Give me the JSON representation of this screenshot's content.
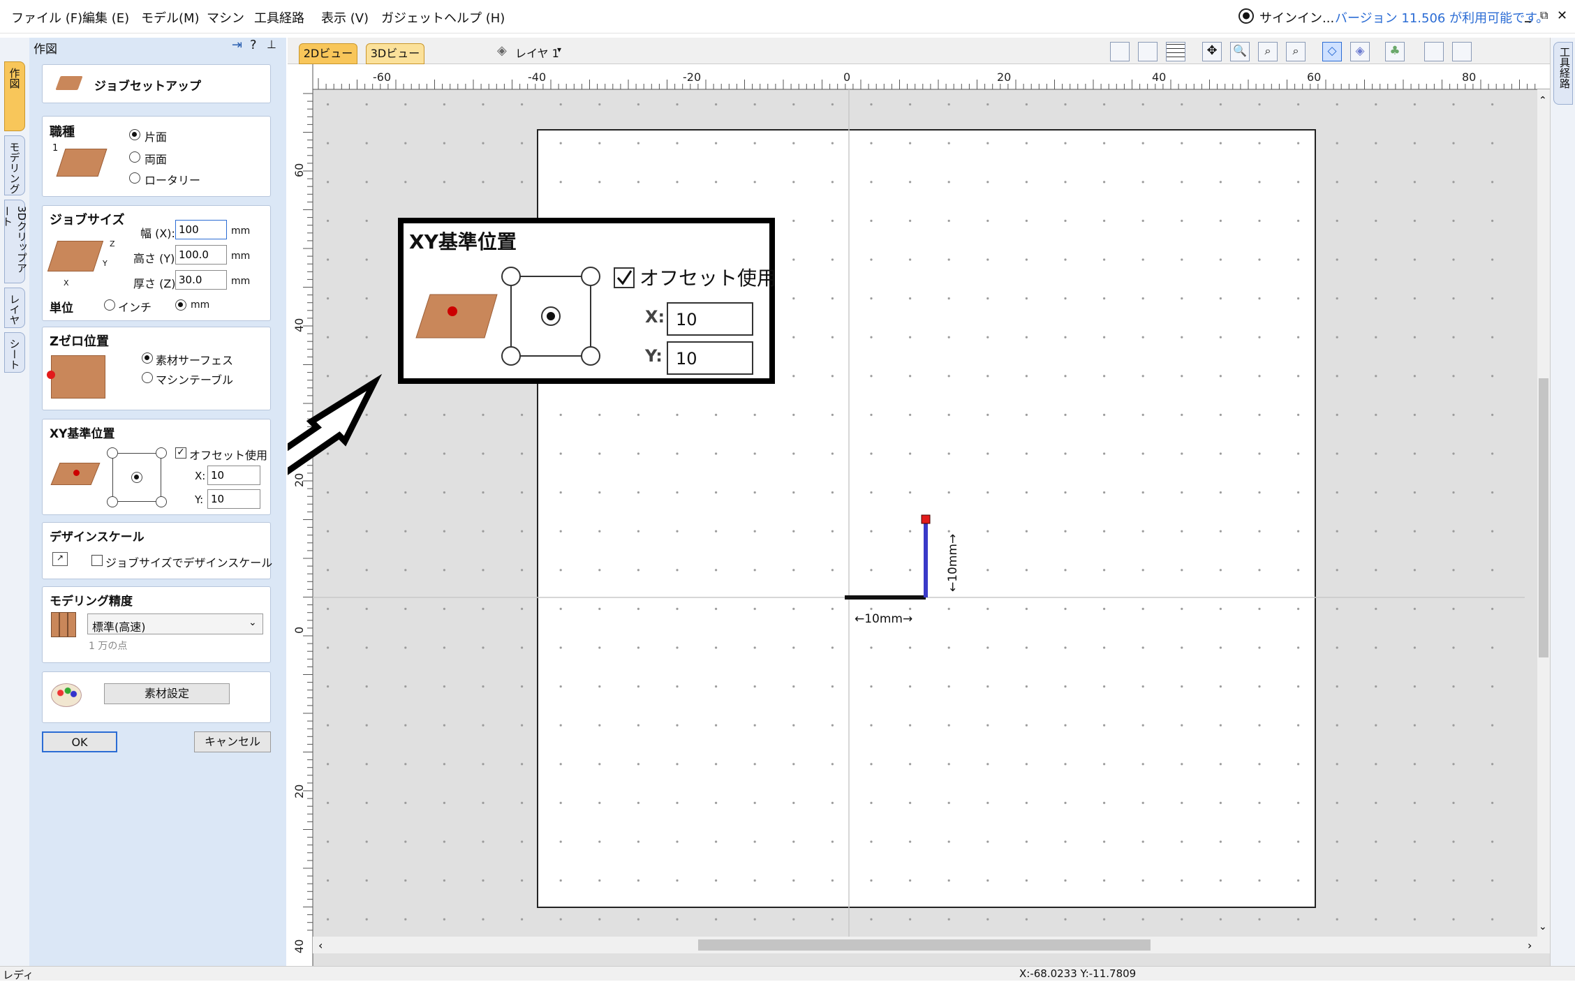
{
  "menu": {
    "items": [
      "ファイル (F)",
      "編集 (E)",
      "モデル(M)",
      "マシン",
      "工具経路",
      "表示 (V)",
      "ガジェット",
      "ヘルプ (H)"
    ],
    "signin": "サインイン...",
    "version_notice": "バージョン 11.506 が利用可能です。"
  },
  "left_tabs": [
    "作図",
    "モデリング",
    "3Dクリップアート",
    "レイヤ",
    "シート"
  ],
  "panel": {
    "title": "作図",
    "job_setup_label": "ジョブセットアップ",
    "job_type": {
      "title": "職種",
      "options": [
        "片面",
        "両面",
        "ロータリー"
      ],
      "selected": "片面"
    },
    "job_size": {
      "title": "ジョブサイズ",
      "width_label": "幅 (X):",
      "width_value": "100",
      "height_label": "高さ (Y):",
      "height_value": "100.0",
      "thickness_label": "厚さ (Z):",
      "thickness_value": "30.0",
      "unit_suffix": "mm",
      "units_title": "単位",
      "unit_options": [
        "インチ",
        "mm"
      ],
      "unit_selected": "mm"
    },
    "z_zero": {
      "title": "Zゼロ位置",
      "options": [
        "素材サーフェス",
        "マシンテーブル"
      ],
      "selected": "素材サーフェス"
    },
    "xy_datum": {
      "title": "XY基準位置",
      "offset_label": "オフセット使用",
      "offset_checked": true,
      "x_label": "X:",
      "x_value": "10",
      "y_label": "Y:",
      "y_value": "10"
    },
    "design_scale": {
      "title": "デザインスケール",
      "checkbox_label": "ジョブサイズでデザインスケール",
      "checked": false
    },
    "modeling": {
      "title": "モデリング精度",
      "selected": "標準(高速)",
      "note": "1 万の点"
    },
    "material_button": "素材設定",
    "ok_button": "OK",
    "cancel_button": "キャンセル"
  },
  "view_tabs": [
    "2Dビュー",
    "3Dビュー"
  ],
  "layer_selector": "レイヤ 1",
  "ruler": {
    "h_ticks": [
      "-60",
      "-40",
      "-20",
      "0",
      "20",
      "40",
      "60",
      "80"
    ],
    "v_ticks": [
      "60",
      "40",
      "20",
      "0",
      "20",
      "40"
    ]
  },
  "zoom_callout": {
    "title": "XY基準位置",
    "offset_label": "オフセット使用",
    "x_label": "X:",
    "x_value": "10",
    "y_label": "Y:",
    "y_value": "10"
  },
  "dimensions": {
    "horizontal": "←10mm→",
    "vertical": "←10mm→"
  },
  "right_strip_label": "工具経路",
  "status": {
    "left": "レディ",
    "coords": "X:-68.0233 Y:-11.7809"
  },
  "colors": {
    "panel_bg": "#dbe7f6",
    "accent": "#2b6cd4",
    "axis_y": "#3a3ac8",
    "origin_marker": "#e21b1b",
    "wood": "#c9875a"
  }
}
